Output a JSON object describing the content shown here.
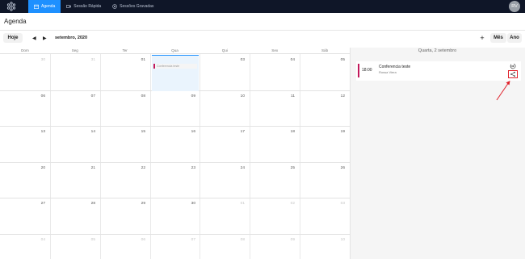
{
  "nav": {
    "tabs": [
      {
        "label": "Agenda"
      },
      {
        "label": "Sessão Rápida"
      },
      {
        "label": "Sessões Gravadas"
      }
    ],
    "avatar_initials": "RV",
    "accent": "#1e90ff",
    "bar_color": "#0f1628"
  },
  "page": {
    "title": "Agenda"
  },
  "toolbar": {
    "today": "Hoje",
    "month_label": "setembro, 2020",
    "add": "+",
    "view_month": "Mês",
    "view_year": "Ano"
  },
  "calendar": {
    "weekdays": [
      "Dom",
      "Seg",
      "Ter",
      "Qua",
      "Qui",
      "Sex",
      "Sáb"
    ],
    "weeks": [
      [
        "30",
        "31",
        "01",
        "02",
        "03",
        "04",
        "05"
      ],
      [
        "06",
        "07",
        "08",
        "09",
        "10",
        "11",
        "12"
      ],
      [
        "13",
        "14",
        "15",
        "16",
        "17",
        "18",
        "19"
      ],
      [
        "20",
        "21",
        "22",
        "23",
        "24",
        "25",
        "26"
      ],
      [
        "27",
        "28",
        "29",
        "30",
        "01",
        "02",
        "03"
      ],
      [
        "04",
        "05",
        "06",
        "07",
        "08",
        "09",
        "10"
      ]
    ],
    "event_chip": "Conferencia teste",
    "event_color": "#c2185b"
  },
  "side": {
    "heading": "Quarta, 2 setembro",
    "event": {
      "time": "18:00",
      "title": "Conferencia teste",
      "subtitle": "Rossa Viera"
    },
    "icons": [
      "enter-icon",
      "share-icon"
    ]
  }
}
